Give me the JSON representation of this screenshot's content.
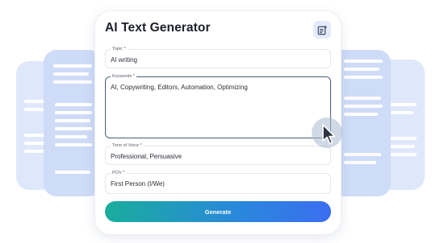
{
  "app": {
    "title": "AI Text Generator",
    "icon": "magic-wand-icon"
  },
  "form": {
    "topic": {
      "label": "Topic *",
      "value": "AI writing"
    },
    "keywords": {
      "label": "Keywords *",
      "value": "AI, Copywriting, Editors, Automation, Optimizing"
    },
    "tone": {
      "label": "Tone of Voice *",
      "value": "Professional, Persuasive"
    },
    "pov": {
      "label": "POV *",
      "value": "First Person (I/We)"
    }
  },
  "actions": {
    "generate_label": "Generate"
  },
  "colors": {
    "accent_start": "#19ad9c",
    "accent_end": "#3b6ef0",
    "bg_card": "#cfdcf8"
  }
}
